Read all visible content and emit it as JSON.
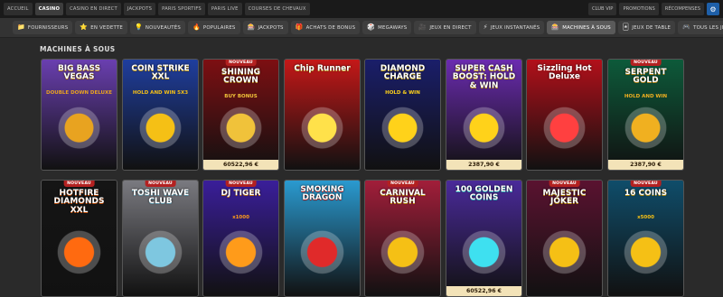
{
  "top_nav": {
    "left": [
      "ACCUEIL",
      "CASINO",
      "CASINO EN DIRECT",
      "JACKPOTS",
      "PARIS SPORTIFS",
      "PARIS LIVE",
      "COURSES DE CHEVAUX"
    ],
    "active": "CASINO",
    "right": [
      "CLUB VIP",
      "PROMOTIONS",
      "RÉCOMPENSES"
    ],
    "settings_icon": "gear-icon"
  },
  "categories": [
    {
      "label": "FOURNISSEURS",
      "icon": "📁",
      "active": false
    },
    {
      "label": "EN VEDETTE",
      "icon": "⭐",
      "active": false
    },
    {
      "label": "NOUVEAUTÉS",
      "icon": "💡",
      "active": false
    },
    {
      "label": "POPULAIRES",
      "icon": "🔥",
      "active": false
    },
    {
      "label": "JACKPOTS",
      "icon": "🎰",
      "active": false
    },
    {
      "label": "ACHATS DE BONUS",
      "icon": "🎁",
      "active": false
    },
    {
      "label": "MEGAWAYS",
      "icon": "🎲",
      "active": false
    },
    {
      "label": "JEUX EN DIRECT",
      "icon": "🎥",
      "active": false
    },
    {
      "label": "JEUX INSTANTANÉS",
      "icon": "⚡",
      "active": false
    },
    {
      "label": "MACHINES À SOUS",
      "icon": "🎰",
      "active": true
    },
    {
      "label": "JEUX DE TABLE",
      "icon": "🃏",
      "active": false
    },
    {
      "label": "TOUS LES JEUX",
      "icon": "🎮",
      "active": false
    }
  ],
  "section_title": "MACHINES À SOUS",
  "badge_label": "NOUVEAU",
  "games": [
    {
      "title": "BIG BASS VEGAS",
      "sub": "DOUBLE DOWN DELUXE",
      "badge": false,
      "jackpot": "",
      "bg": "#6a3fb0",
      "accent": "#e8a320"
    },
    {
      "title": "COIN STRIKE XXL",
      "sub": "HOLD AND WIN 5X3",
      "badge": false,
      "jackpot": "",
      "bg": "#1f3e9e",
      "accent": "#f5c015"
    },
    {
      "title": "SHINING CROWN",
      "sub": "BUY BONUS",
      "badge": true,
      "jackpot": "60522,96 €",
      "bg": "#7d0f12",
      "accent": "#f0c23a"
    },
    {
      "title": "Chip Runner",
      "sub": "",
      "badge": false,
      "jackpot": "",
      "bg": "#c41818",
      "accent": "#ffe14a"
    },
    {
      "title": "DIAMOND CHARGE",
      "sub": "HOLD & WIN",
      "badge": false,
      "jackpot": "",
      "bg": "#1a1e6a",
      "accent": "#ffd21a"
    },
    {
      "title": "SUPER CASH BOOST: HOLD & WIN",
      "sub": "",
      "badge": false,
      "jackpot": "2387,90 €",
      "bg": "#6b2bb0",
      "accent": "#ffd21a"
    },
    {
      "title": "Sizzling Hot Deluxe",
      "sub": "",
      "badge": false,
      "jackpot": "",
      "bg": "#b2101a",
      "accent": "#ff4040"
    },
    {
      "title": "SERPENT GOLD",
      "sub": "HOLD AND WIN",
      "badge": true,
      "jackpot": "2387,90 €",
      "bg": "#0d5a3a",
      "accent": "#f0b020"
    },
    {
      "title": "HOTFIRE DIAMONDS XXL",
      "sub": "",
      "badge": true,
      "jackpot": "",
      "bg": "#151515",
      "accent": "#ff6a10"
    },
    {
      "title": "TOSHI WAVE CLUB",
      "sub": "",
      "badge": true,
      "jackpot": "",
      "bg": "#7a7a80",
      "accent": "#7ec7e0"
    },
    {
      "title": "DJ TIGER",
      "sub": "x1000",
      "badge": true,
      "jackpot": "",
      "bg": "#3a1e9a",
      "accent": "#ff9b1a"
    },
    {
      "title": "SMOKING DRAGON",
      "sub": "",
      "badge": false,
      "jackpot": "",
      "bg": "#2a9ad0",
      "accent": "#e02a2a"
    },
    {
      "title": "CARNIVAL RUSH",
      "sub": "",
      "badge": true,
      "jackpot": "",
      "bg": "#a21e3a",
      "accent": "#f5c015"
    },
    {
      "title": "100 GOLDEN COINS",
      "sub": "",
      "badge": false,
      "jackpot": "60522,96 €",
      "bg": "#4a2a9a",
      "accent": "#3ee0f0"
    },
    {
      "title": "MAJESTIC JOKER",
      "sub": "",
      "badge": true,
      "jackpot": "",
      "bg": "#5a1230",
      "accent": "#f5c015"
    },
    {
      "title": "16 COINS",
      "sub": "x5000",
      "badge": true,
      "jackpot": "",
      "bg": "#0f4d6a",
      "accent": "#f5c015"
    }
  ]
}
